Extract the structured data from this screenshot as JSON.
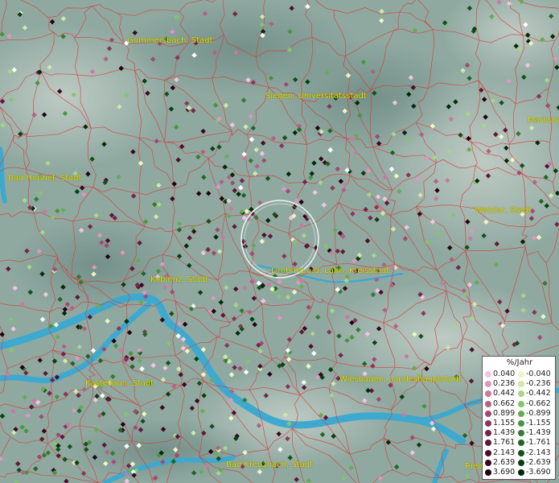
{
  "map": {
    "cities": [
      {
        "name": "Gummersbach, Stadt"
      },
      {
        "name": "Siegen, Universitätsstadt"
      },
      {
        "name": "Marburg"
      },
      {
        "name": "Bad Honnef, Stadt"
      },
      {
        "name": "Wetzlar, Stadt"
      },
      {
        "name": "Koblenz, Stadt"
      },
      {
        "name": "Limburg a.d. Lahn, Kreisstadt"
      },
      {
        "name": "Kastellaun, Stadt"
      },
      {
        "name": "Wiesbaden, Landeshauptstadt"
      },
      {
        "name": "Bad Kreuznach, Stadt"
      },
      {
        "name": "Ried"
      }
    ]
  },
  "legend": {
    "title": "%/Jahr",
    "positive": [
      "0.040",
      "0.236",
      "0.442",
      "0.662",
      "0.899",
      "1.155",
      "1.439",
      "1.761",
      "2.143",
      "2.639",
      "3.690"
    ],
    "negative": [
      "-0.040",
      "-0.236",
      "-0.442",
      "-0.662",
      "-0.899",
      "-1.155",
      "-1.439",
      "-1.761",
      "-2.143",
      "-2.639",
      "-3.690"
    ],
    "pos_colors": [
      "#f2c4e2",
      "#dd97c0",
      "#c97aa0",
      "#b66085",
      "#a24a70",
      "#8c355a",
      "#762447",
      "#621637",
      "#4e0c29",
      "#3b051c",
      "#220010"
    ],
    "neg_colors": [
      "#eef7c4",
      "#cfe9a6",
      "#a8d587",
      "#86c46b",
      "#66ad52",
      "#4a943f",
      "#337c30",
      "#1f6624",
      "#125219",
      "#073f10",
      "#002a07"
    ]
  }
}
